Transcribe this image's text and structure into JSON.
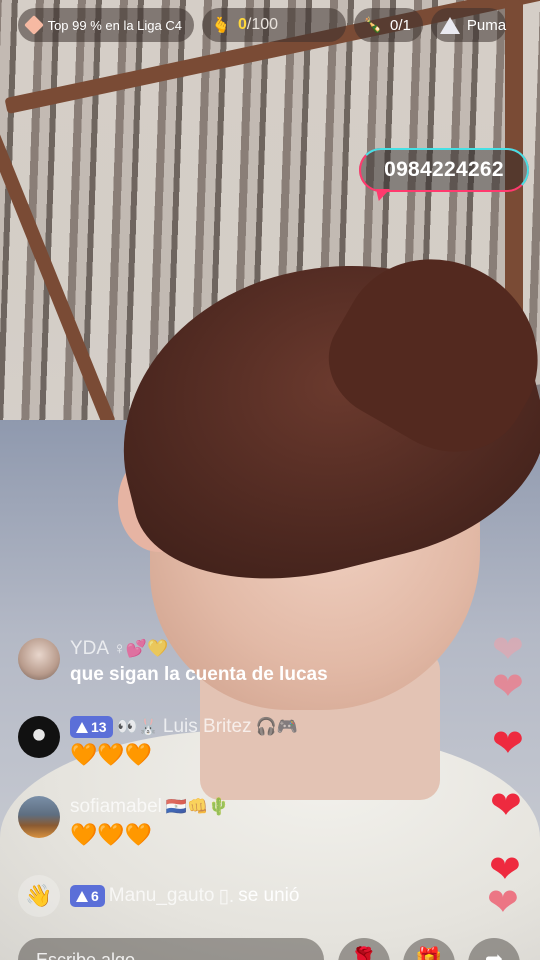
{
  "topbar": {
    "league_text": "Top 99 % en la Liga C4",
    "gift_current": "0",
    "gift_total": "/100",
    "rank_value": "0/1",
    "puma_label": "Puma"
  },
  "overlay": {
    "phone_number": "0984224262"
  },
  "comments": [
    {
      "user": "YDA",
      "user_emojis": "♀💕💛",
      "text": "que sigan la cuenta de lucas"
    },
    {
      "badge": "13",
      "user_prefix": "👀🐰",
      "user": "Luis Britez",
      "user_emojis": "🎧🎮",
      "text": "🧡🧡🧡"
    },
    {
      "user": "sofiamabel",
      "user_emojis": "🇵🇾👊🌵",
      "text": "🧡🧡🧡"
    },
    {
      "badge": "6",
      "user": "Manu_gauto",
      "user_suffix": "▯.",
      "joined": "se unió"
    }
  ],
  "bottom": {
    "comment_placeholder": "Escribe algo...",
    "rose_icon": "rose-icon",
    "gift_icon": "gift-icon",
    "share_icon": "share-icon"
  },
  "colors": {
    "badge_blue": "#5b6fd8",
    "heart_red": "#ee2a3f",
    "gift_yellow": "#ffd83a",
    "bubble_pink": "#ff3a6e",
    "bubble_cyan": "#46e0e4"
  }
}
